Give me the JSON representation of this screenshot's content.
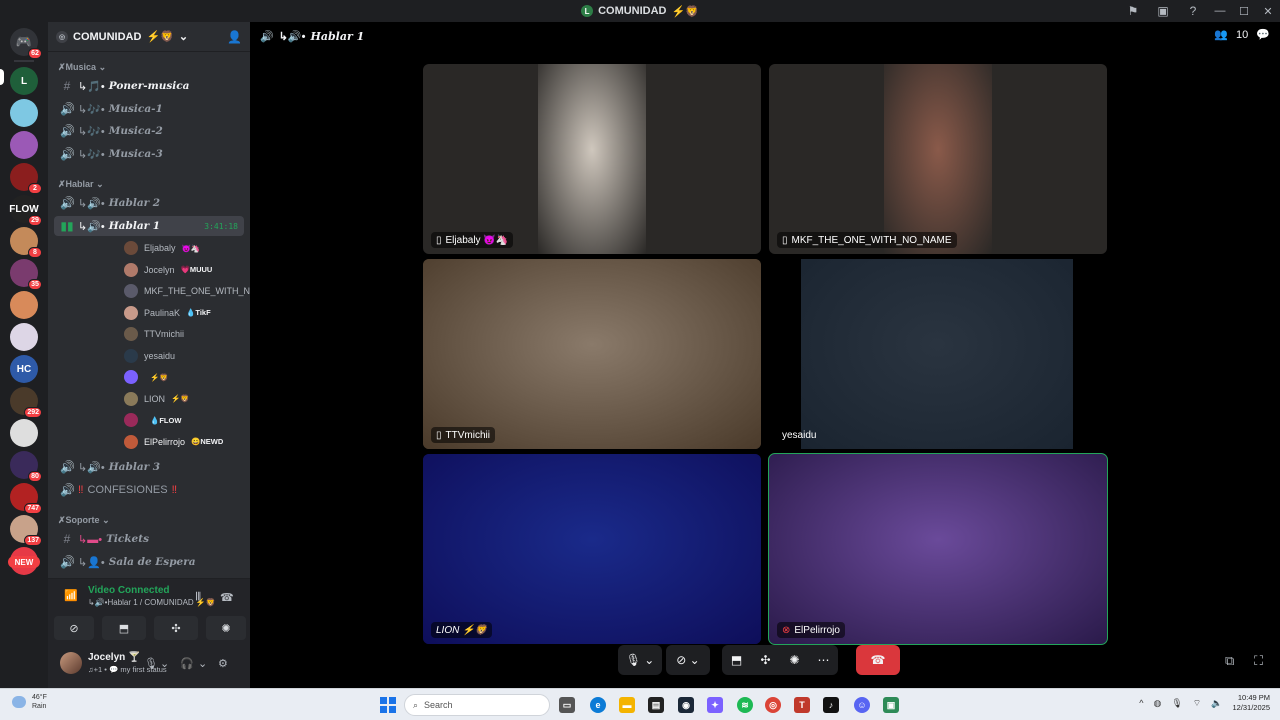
{
  "window": {
    "title": "COMUNIDAD",
    "title_emojis": "⚡🦁"
  },
  "rail": {
    "home_badge": "62",
    "servers": [
      {
        "abbr": "L",
        "color": "#1f5f3a",
        "badge": ""
      },
      {
        "abbr": "",
        "color": "#7ec8e3",
        "badge": ""
      },
      {
        "abbr": "",
        "color": "#9b59b6",
        "badge": ""
      },
      {
        "abbr": "",
        "color": "#8b1e1e",
        "badge": "2"
      },
      {
        "abbr": "FLOW",
        "color": "#222222",
        "badge": "29"
      },
      {
        "abbr": "",
        "color": "#c48a5a",
        "badge": "8"
      },
      {
        "abbr": "",
        "color": "#7a3b6e",
        "badge": "35"
      },
      {
        "abbr": "",
        "color": "#d88a5a",
        "badge": ""
      },
      {
        "abbr": "",
        "color": "#ddd6e6",
        "badge": ""
      },
      {
        "abbr": "HC",
        "color": "#2e5aa8",
        "badge": ""
      },
      {
        "abbr": "",
        "color": "#4a3a2a",
        "badge": "292"
      },
      {
        "abbr": "",
        "color": "#dedede",
        "badge": ""
      },
      {
        "abbr": "",
        "color": "#3a2a5a",
        "badge": "80"
      },
      {
        "abbr": "",
        "color": "#b22222",
        "badge": "747"
      },
      {
        "abbr": "",
        "color": "#c8a28a",
        "badge": "137"
      },
      {
        "abbr": "",
        "color": "#e63946",
        "badge": ""
      }
    ],
    "new_label": "NEW"
  },
  "guild": {
    "name": "COMUNIDAD",
    "emojis": "⚡🦁"
  },
  "channels": {
    "cat_musica": "Musica",
    "poner_musica": "Poner-musica",
    "musica1": "Musica-1",
    "musica2": "Musica-2",
    "musica3": "Musica-3",
    "cat_hablar": "Hablar",
    "hablar2": "Hablar 2",
    "hablar1": "Hablar 1",
    "hablar1_timer": "3:41:18",
    "hablar3": "Hablar 3",
    "confesiones": "CONFESIONES",
    "cat_soporte": "Soporte",
    "tickets": "Tickets",
    "sala_espera": "Sala de Espera",
    "prefix_voice": "↳🔊•",
    "prefix_text": "↳🎵•",
    "prefix_music": "↳🎶•"
  },
  "voice_users": [
    {
      "name": "Eljabaly",
      "tag": "😈🦄",
      "color": "#6b4a3a"
    },
    {
      "name": "Jocelyn",
      "tag": "💗MUUU",
      "color": "#b07a6a"
    },
    {
      "name": "MKF_THE_ONE_WITH_NO_...",
      "tag": "",
      "color": "#5a5a6a"
    },
    {
      "name": "PaulinaK",
      "tag": "💧TikF",
      "color": "#c89a8a"
    },
    {
      "name": "TTVmichii",
      "tag": "",
      "color": "#6a5a4a"
    },
    {
      "name": "yesaidu",
      "tag": "",
      "color": "#2a3a4a"
    },
    {
      "name": "",
      "tag": "⚡🦁",
      "color": "#7b61ff"
    },
    {
      "name": "LION",
      "tag": "⚡🦁",
      "color": "#8a7a5a"
    },
    {
      "name": "",
      "tag": "💧FLOW",
      "color": "#9a2a5a"
    },
    {
      "name": "ElPelirrojo",
      "tag": "😀NEWD",
      "color": "#c05a3a"
    }
  ],
  "voice_panel": {
    "status": "Video Connected",
    "location": "Hablar 1 / COMUNIDAD ⚡🦁"
  },
  "user": {
    "name": "Jocelyn",
    "status": "my first status"
  },
  "stage": {
    "channel_name": "Hablar 1",
    "participant_count": "10",
    "tiles": [
      {
        "label": "Eljabaly 😈🦄",
        "bg": "#2a2826",
        "feed": "#cfc7bd"
      },
      {
        "label": "MKF_THE_ONE_WITH_NO_NAME",
        "bg": "#2a2826",
        "feed": "#8a5a4a"
      },
      {
        "label": "TTVmichii",
        "bg": "#4a3a2a",
        "feed": "#8a7a6a"
      },
      {
        "label": "yesaidu",
        "bg": "#1a2430",
        "feed": "#2a3440"
      },
      {
        "label": "LION ⚡🦁",
        "bg": "#0e0e5a",
        "feed": "#1a2a8a"
      },
      {
        "label": "ElPelirrojo",
        "bg": "#2a1a4a",
        "feed": "#6a4a9a"
      }
    ]
  },
  "taskbar": {
    "temp": "46°F",
    "weather": "Rain",
    "search_placeholder": "Search",
    "time": "10:49 PM",
    "date": "12/31/2025"
  }
}
